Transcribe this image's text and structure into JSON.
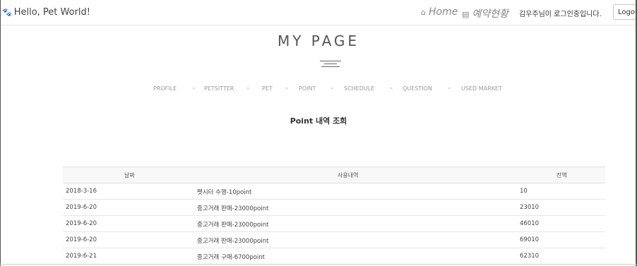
{
  "navbar": {
    "brand": "Hello, Pet World!",
    "links": [
      {
        "label": "Home",
        "icon": "home-icon"
      },
      {
        "label": "예약현황",
        "icon": "calendar-icon"
      }
    ],
    "welcome_text": "김우주님이 로그인중입니다.",
    "logout_label": "Logout"
  },
  "page": {
    "title": "MY PAGE",
    "subnav": [
      "PROFILE",
      "PETSITTER",
      "PET",
      "POINT",
      "SCHEDULE",
      "QUESTION",
      "USED MARKET"
    ],
    "section_title": "Point 내역 조회"
  },
  "table": {
    "headers": [
      "날짜",
      "사용내역",
      "잔액"
    ],
    "rows": [
      {
        "date": "2018-3-16",
        "desc": "펫시터 수행-10point",
        "balance": "10"
      },
      {
        "date": "2019-6-20",
        "desc": "중고거래 판매-23000point",
        "balance": "23010"
      },
      {
        "date": "2019-6-20",
        "desc": "중고거래 판매-23000point",
        "balance": "46010"
      },
      {
        "date": "2019-6-20",
        "desc": "중고거래 판매-23000point",
        "balance": "69010"
      },
      {
        "date": "2019-6-21",
        "desc": "중고거래 구매-6700point",
        "balance": "62310"
      }
    ]
  }
}
